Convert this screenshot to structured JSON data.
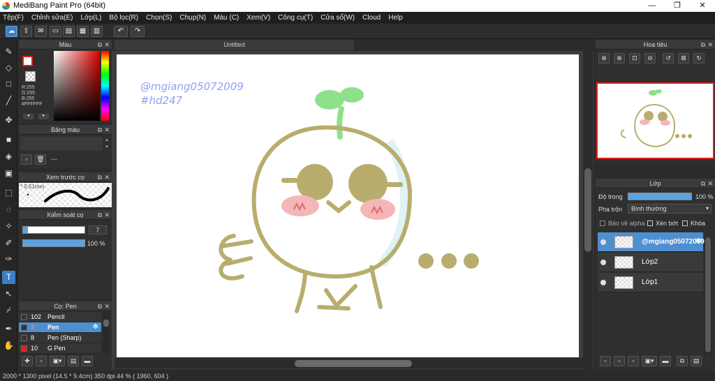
{
  "window": {
    "title": "MediBang Paint Pro (64bit)",
    "minimize": "—",
    "maximize": "❐",
    "close": "✕"
  },
  "menu": [
    "Tệp(F)",
    "Chỉnh sửa(E)",
    "Lớp(L)",
    "Bộ lọc(R)",
    "Chọn(S)",
    "Chụp(N)",
    "Màu (C)",
    "Xem(V)",
    "Công cụ(T)",
    "Cửa sổ(W)",
    "Cloud",
    "Help"
  ],
  "color_panel": {
    "title": "Màu",
    "r": "R:255",
    "g": "G:255",
    "b": "B:255",
    "hex": "#FFFFFF",
    "primary": "#e02020",
    "secondary": "#ffffff"
  },
  "palette_panel": {
    "title": "Bảng màu",
    "dash": "---"
  },
  "brush_preview": {
    "title": "Xem trước cọ",
    "size": "0.51mm"
  },
  "brush_control": {
    "title": "Kiểm soát cọ",
    "size_value": "7",
    "opacity_value": "100 %",
    "opacity_fraction": 1.0,
    "size_fraction": 0.08
  },
  "brush_list": {
    "title": "Cọ: Pen",
    "items": [
      {
        "size": "102",
        "name": "Pencil",
        "color": "#353535"
      },
      {
        "size": "7",
        "name": "Pen",
        "color": "#353535"
      },
      {
        "size": "8",
        "name": "Pen (Sharp)",
        "color": "#353535"
      },
      {
        "size": "10",
        "name": "G Pen",
        "color": "#e02020"
      }
    ]
  },
  "canvas": {
    "tab": "Untitled",
    "watermark_line1": "@mgiang05072009",
    "watermark_line2": "#hd247",
    "line_color": "#b9ad6e",
    "sprout_color": "#8fe08a",
    "blush_color": "#f4b6b6"
  },
  "navigator": {
    "title": "Hoa tiêu"
  },
  "layer_panel": {
    "title": "Lớp",
    "opacity_label": "Độ trong",
    "opacity_value": "100 %",
    "opacity_fraction": 1.0,
    "blend_label": "Pha trộn",
    "blend_value": "Bình thường",
    "protect_alpha": "Bảo vệ alpha",
    "clipping": "Xén bớt",
    "lock": "Khóa",
    "layers": [
      {
        "name": "@mgiang05072009",
        "selected": true
      },
      {
        "name": "Lớp2",
        "selected": false
      },
      {
        "name": "Lớp1",
        "selected": false
      }
    ]
  },
  "status": {
    "text": "2000 * 1300 pixel   (14.5 * 9.4cm)   350 dpi   44 %   ( 1960, 604 )"
  }
}
